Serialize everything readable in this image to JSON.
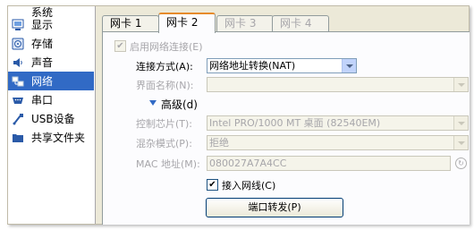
{
  "sidebar": {
    "items": [
      {
        "label": "系统",
        "icon": "system-icon",
        "selected": false
      },
      {
        "label": "显示",
        "icon": "display-icon",
        "selected": false
      },
      {
        "label": "存储",
        "icon": "storage-icon",
        "selected": false
      },
      {
        "label": "声音",
        "icon": "audio-icon",
        "selected": false
      },
      {
        "label": "网络",
        "icon": "network-icon",
        "selected": true
      },
      {
        "label": "串口",
        "icon": "serial-port-icon",
        "selected": false
      },
      {
        "label": "USB设备",
        "icon": "usb-icon",
        "selected": false
      },
      {
        "label": "共享文件夹",
        "icon": "shared-folder-icon",
        "selected": false
      }
    ]
  },
  "tabs": [
    {
      "label": "网卡 1",
      "active": false,
      "disabled": false
    },
    {
      "label": "网卡 2",
      "active": true,
      "disabled": false
    },
    {
      "label": "网卡 3",
      "active": false,
      "disabled": true
    },
    {
      "label": "网卡 4",
      "active": false,
      "disabled": true
    }
  ],
  "adapter": {
    "enable_label": "启用网络连接(E)",
    "enable_checked": true,
    "attached_label": "连接方式(A):",
    "attached_value": "网络地址转换(NAT)",
    "name_label": "界面名称(N):",
    "name_value": "",
    "advanced_label": "高级(d)",
    "chip_label": "控制芯片(T):",
    "chip_value": "Intel PRO/1000 MT 桌面 (82540EM)",
    "promisc_label": "混杂模式(P):",
    "promisc_value": "拒绝",
    "mac_label": "MAC 地址(M):",
    "mac_value": "080027A7A4CC",
    "cable_label": "接入网线(C)",
    "cable_checked": true,
    "port_forward_label": "端口转发(P)"
  },
  "colors": {
    "selection": "#316ac5",
    "dialog_bg": "#ece9d8",
    "active_tab_accent": "#e68b2c"
  }
}
